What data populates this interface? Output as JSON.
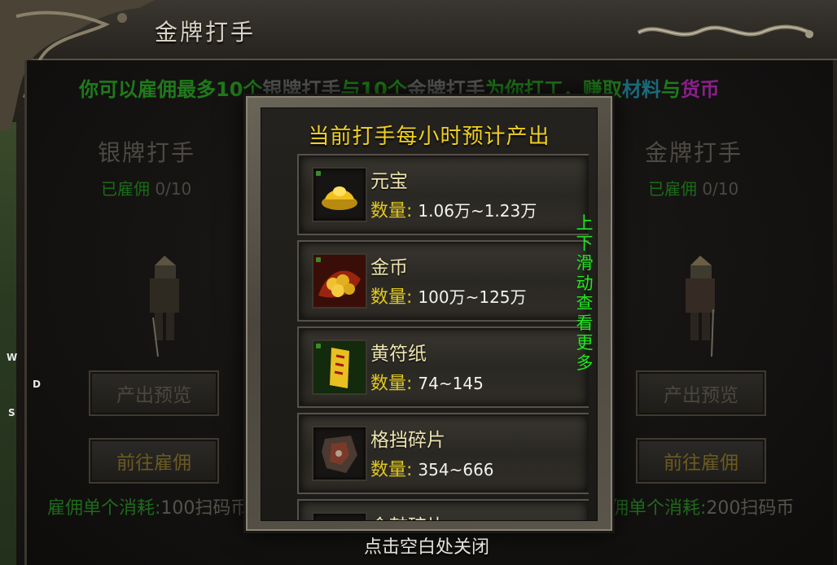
{
  "window": {
    "title": "金牌打手"
  },
  "banner": {
    "segments": [
      {
        "text": "你可以雇佣最多10个",
        "color": "green"
      },
      {
        "text": "银牌打手",
        "color": "grey"
      },
      {
        "text": "与10个",
        "color": "green"
      },
      {
        "text": "金牌打手",
        "color": "grey"
      },
      {
        "text": "为你打工，赚取",
        "color": "green"
      },
      {
        "text": "材料",
        "color": "teal"
      },
      {
        "text": "与",
        "color": "green"
      },
      {
        "text": "货币",
        "color": "purple"
      }
    ]
  },
  "silver": {
    "title": "银牌打手",
    "hired_label": "已雇佣",
    "hired_value": "0/10",
    "preview_button": "产出预览",
    "hire_button": "前往雇佣",
    "cost_label": "雇佣单个消耗:",
    "cost_value": "100扫码币"
  },
  "gold": {
    "title": "金牌打手",
    "hired_label": "已雇佣",
    "hired_value": "0/10",
    "preview_button": "产出预览",
    "hire_button": "前往雇佣",
    "cost_label": "佣单个消耗:",
    "cost_value": "200扫码币"
  },
  "popup": {
    "title": "当前打手每小时预计产出",
    "qty_label": "数量:",
    "items": [
      {
        "name": "元宝",
        "qty": "1.06万~1.23万",
        "icon": "gold-ingot-icon"
      },
      {
        "name": "金币",
        "qty": "100万~125万",
        "icon": "gold-coins-icon"
      },
      {
        "name": "黄符纸",
        "qty": "74~145",
        "icon": "talisman-paper-icon"
      },
      {
        "name": "格挡碎片",
        "qty": "354~666",
        "icon": "shield-fragment-icon"
      },
      {
        "name": "金鼓碎片",
        "qty": "",
        "icon": "fragment-icon"
      }
    ],
    "scroll_hint": [
      "上",
      "下",
      "滑",
      "动",
      "查",
      "看",
      "更",
      "多"
    ],
    "close_hint": "点击空白处关闭"
  },
  "minimap_labels": {
    "w": "W",
    "d": "D",
    "s": "S"
  },
  "colors": {
    "banner_green": "#1f7a1a",
    "popup_title": "#f0d020",
    "qty_label": "#e2c820",
    "scroll_hint": "#1ee81e"
  }
}
